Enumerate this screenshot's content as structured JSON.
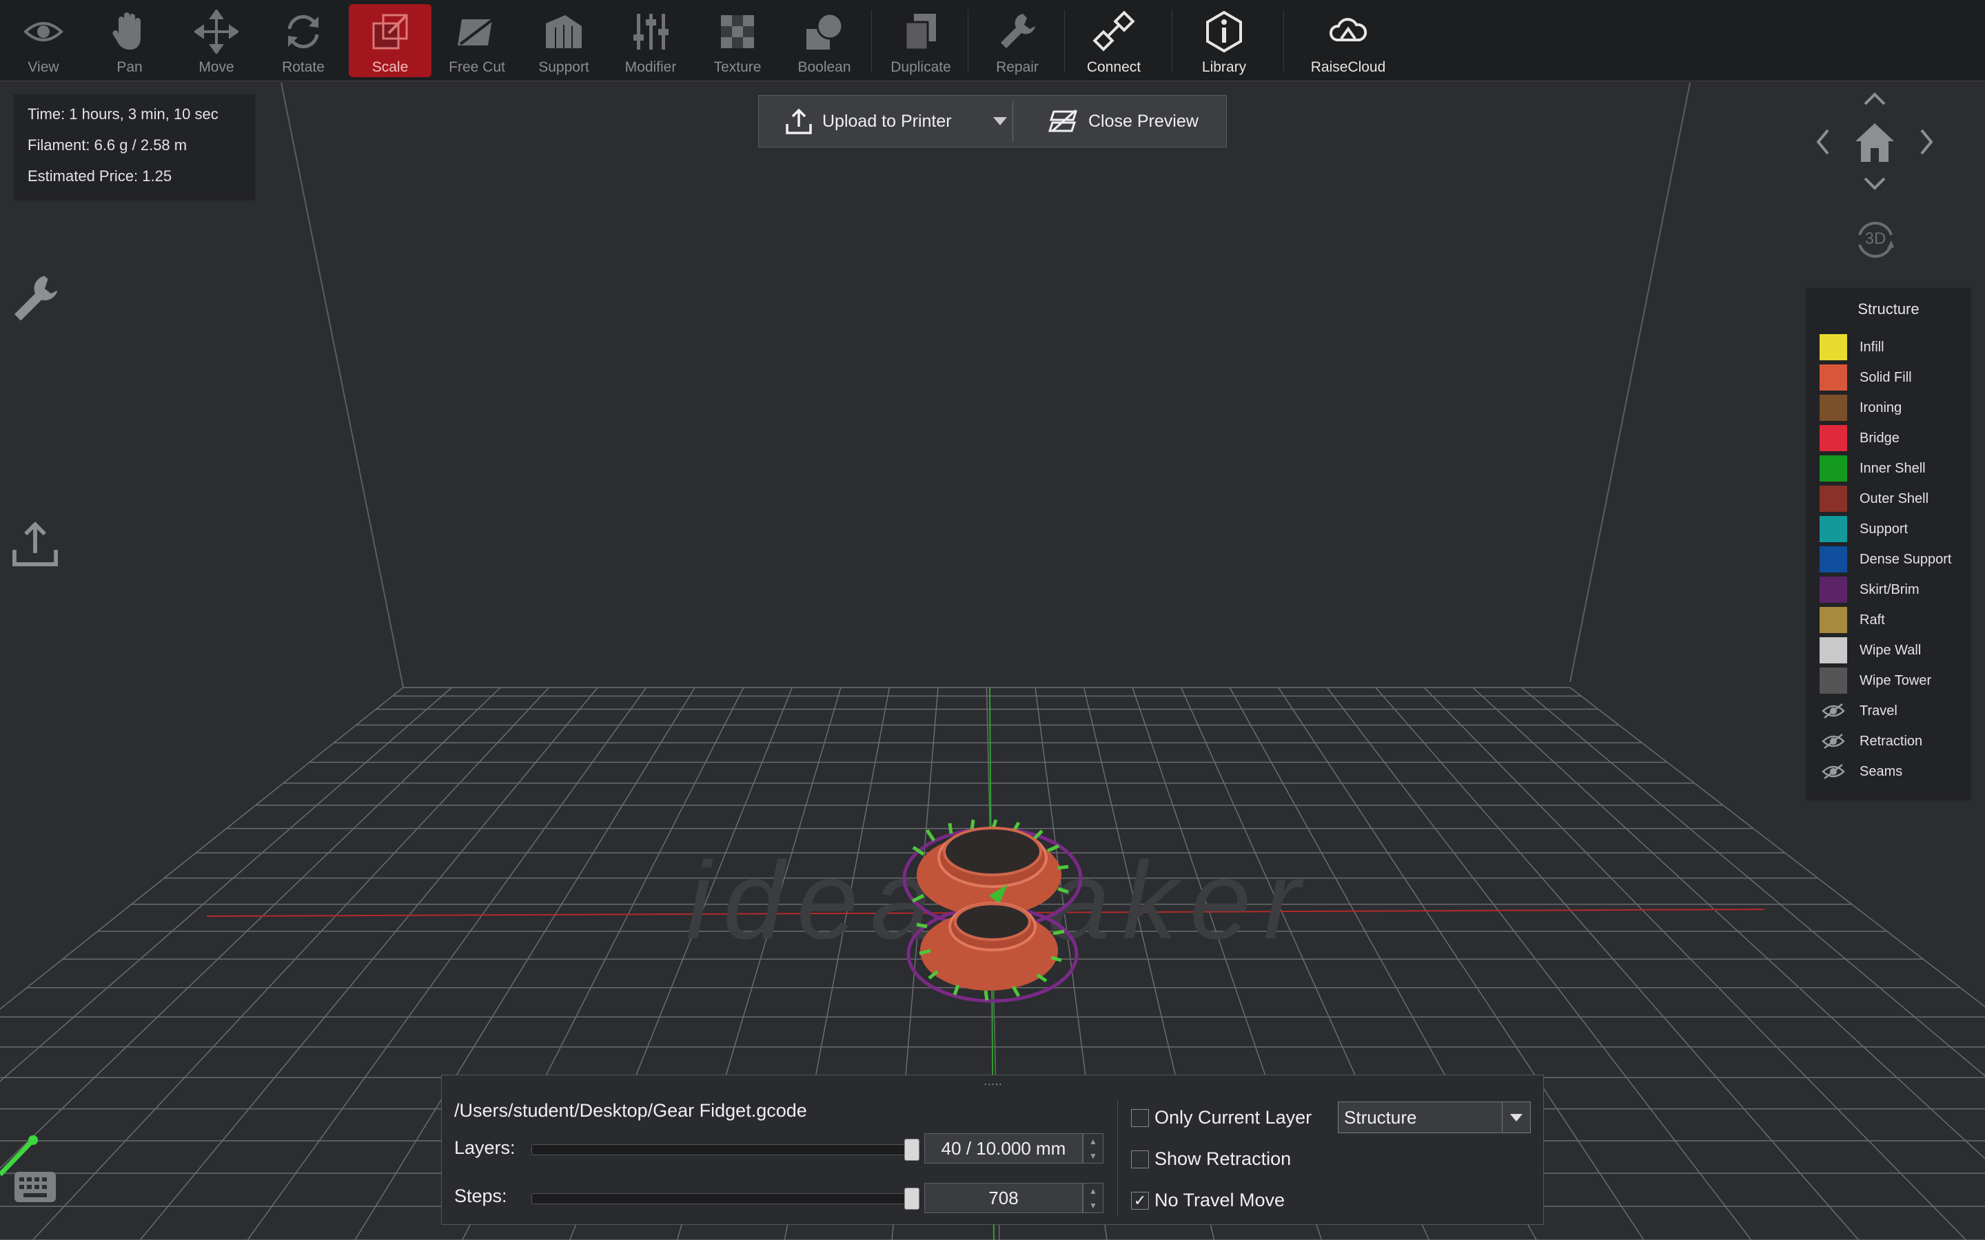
{
  "toolbar": {
    "items": [
      {
        "label": "View",
        "icon": "eye-icon"
      },
      {
        "label": "Pan",
        "icon": "hand-icon"
      },
      {
        "label": "Move",
        "icon": "move-arrows-icon"
      },
      {
        "label": "Rotate",
        "icon": "rotate-icon"
      },
      {
        "label": "Scale",
        "icon": "scale-icon",
        "active": true
      },
      {
        "label": "Free Cut",
        "icon": "cut-icon"
      },
      {
        "label": "Support",
        "icon": "support-icon"
      },
      {
        "label": "Modifier",
        "icon": "sliders-icon"
      },
      {
        "label": "Texture",
        "icon": "checker-icon"
      },
      {
        "label": "Boolean",
        "icon": "boolean-icon"
      },
      {
        "label": "Duplicate",
        "icon": "duplicate-icon"
      },
      {
        "label": "Repair",
        "icon": "wrench-icon"
      },
      {
        "label": "Connect",
        "icon": "connect-icon"
      },
      {
        "label": "Library",
        "icon": "info-hex-icon"
      },
      {
        "label": "RaiseCloud",
        "icon": "cloud-icon"
      }
    ]
  },
  "info": {
    "time": "Time: 1 hours, 3 min, 10 sec",
    "filament": "Filament: 6.6 g / 2.58 m",
    "price": "Estimated Price: 1.25"
  },
  "preview": {
    "upload_label": "Upload to Printer",
    "close_label": "Close Preview"
  },
  "nav": {
    "mode_3d": "3D"
  },
  "legend": {
    "title": "Structure",
    "items": [
      {
        "label": "Infill",
        "color": "#e8dc2e"
      },
      {
        "label": "Solid Fill",
        "color": "#d8573a"
      },
      {
        "label": "Ironing",
        "color": "#7a4f2a"
      },
      {
        "label": "Bridge",
        "color": "#e02a3c"
      },
      {
        "label": "Inner Shell",
        "color": "#149a1e"
      },
      {
        "label": "Outer Shell",
        "color": "#8a3229"
      },
      {
        "label": "Support",
        "color": "#12999a"
      },
      {
        "label": "Dense Support",
        "color": "#0f4f9e"
      },
      {
        "label": "Skirt/Brim",
        "color": "#5b2468"
      },
      {
        "label": "Raft",
        "color": "#a88a3c"
      },
      {
        "label": "Wipe Wall",
        "color": "#c9c9c9"
      },
      {
        "label": "Wipe Tower",
        "color": "#555555"
      }
    ],
    "hidden_items": [
      {
        "label": "Travel"
      },
      {
        "label": "Retraction"
      },
      {
        "label": "Seams"
      }
    ]
  },
  "viewport": {
    "watermark": "ideaMaker"
  },
  "bottom": {
    "file_path": "/Users/student/Desktop/Gear Fidget.gcode",
    "layers_label": "Layers:",
    "layers_value": "40 / 10.000 mm",
    "layers_fraction": 1.0,
    "steps_label": "Steps:",
    "steps_value": "708",
    "steps_fraction": 1.0,
    "only_current_layer": {
      "label": "Only Current Layer",
      "checked": false
    },
    "show_retraction": {
      "label": "Show Retraction",
      "checked": false
    },
    "no_travel_move": {
      "label": "No Travel Move",
      "checked": true
    },
    "view_mode": "Structure"
  }
}
